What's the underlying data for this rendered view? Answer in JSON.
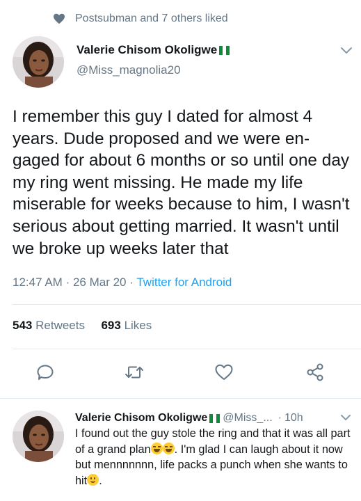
{
  "social_context": {
    "text": "Postsubman and 7 others liked",
    "icon": "heart-icon"
  },
  "tweet": {
    "author": {
      "display_name": "Valerie Chisom Okoligwe",
      "handle": "@Miss_magnolia20",
      "flag": "nigeria-flag"
    },
    "text": "I remember this guy I dated for almost 4 years. Dude proposed and we were en-gaged for about 6 months or so until one day my ring went missing. He made my life miserable for weeks because to him, I wasn't serious about getting married. It wasn't until we broke up weeks later that",
    "time": "12:47 AM",
    "date": "26 Mar 20",
    "separator": "·",
    "source": "Twitter for Android",
    "retweets_count": "543",
    "retweets_label": "Retweets",
    "likes_count": "693",
    "likes_label": "Likes"
  },
  "actions": [
    {
      "name": "reply",
      "icon": "reply-icon"
    },
    {
      "name": "retweet",
      "icon": "retweet-icon"
    },
    {
      "name": "like",
      "icon": "heart-outline-icon"
    },
    {
      "name": "share",
      "icon": "share-icon"
    }
  ],
  "reply": {
    "display_name": "Valerie Chisom Okoligwe",
    "handle": "@Miss_...",
    "separator": "·",
    "time": "10h",
    "text_part1": "I found out the guy stole the ring and that it was all part of a grand plan",
    "text_part2": ". I'm glad I can laugh about it now but mennnnnnn, life packs a punch when she wants to hit",
    "text_part3": "."
  },
  "colors": {
    "accent": "#1da1f2",
    "secondary_text": "#657786",
    "primary_text": "#14171a",
    "divider": "#e1e8ed"
  }
}
